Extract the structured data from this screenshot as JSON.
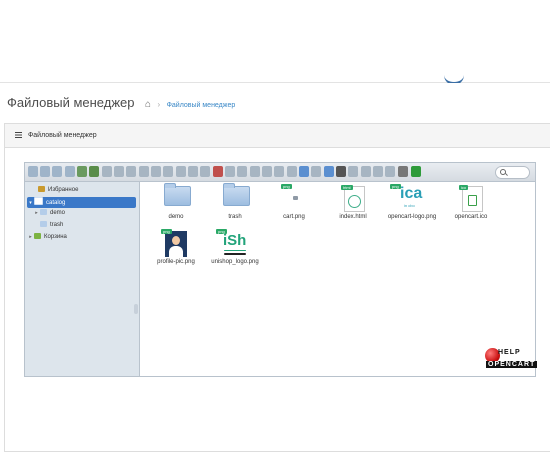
{
  "page": {
    "title": "Файловый менеджер",
    "breadcrumb": "Файловый менеджер"
  },
  "panel": {
    "heading": "Файловый менеджер"
  },
  "toolbar": {
    "icons": [
      {
        "name": "back-icon",
        "color": "#9fb4c9"
      },
      {
        "name": "forward-icon",
        "color": "#9fb4c9"
      },
      {
        "name": "up-icon",
        "color": "#9fb4c9"
      },
      {
        "name": "home-icon",
        "color": "#9fb4c9"
      },
      {
        "name": "reload-icon",
        "color": "#6a9a5f"
      },
      {
        "name": "download-icon",
        "color": "#5a8d4a"
      },
      {
        "name": "upload-icon",
        "color": "#a7b5c2"
      },
      {
        "name": "new-folder-icon",
        "color": "#a7b5c2"
      },
      {
        "name": "new-file-icon",
        "color": "#a7b5c2"
      },
      {
        "name": "open-icon",
        "color": "#a7b5c2"
      },
      {
        "name": "undo-icon",
        "color": "#a7b5c2"
      },
      {
        "name": "redo-icon",
        "color": "#a7b5c2"
      },
      {
        "name": "copy-icon",
        "color": "#a7b5c2"
      },
      {
        "name": "cut-icon",
        "color": "#a7b5c2"
      },
      {
        "name": "paste-icon",
        "color": "#a7b5c2"
      },
      {
        "name": "delete-icon",
        "color": "#c0504d"
      },
      {
        "name": "duplicate-icon",
        "color": "#a7b5c2"
      },
      {
        "name": "rename-icon",
        "color": "#a7b5c2"
      },
      {
        "name": "edit-icon",
        "color": "#a7b5c2"
      },
      {
        "name": "resize-icon",
        "color": "#a7b5c2"
      },
      {
        "name": "archive-icon",
        "color": "#a7b5c2"
      },
      {
        "name": "extract-icon",
        "color": "#a7b5c2"
      },
      {
        "name": "grid-view-icon",
        "color": "#5b8fd0"
      },
      {
        "name": "list-view-icon",
        "color": "#a7b5c2"
      },
      {
        "name": "select-icon",
        "color": "#5b8fd0"
      },
      {
        "name": "preview-icon",
        "color": "#555555"
      },
      {
        "name": "info-icon",
        "color": "#a7b5c2"
      },
      {
        "name": "sort-icon",
        "color": "#a7b5c2"
      },
      {
        "name": "places-icon",
        "color": "#a7b5c2"
      },
      {
        "name": "help-icon",
        "color": "#a7b5c2"
      },
      {
        "name": "settings-icon",
        "color": "#777777"
      },
      {
        "name": "fullscreen-icon",
        "color": "#2e9b3a"
      }
    ]
  },
  "tree": {
    "items": [
      {
        "label": "Избранное",
        "color": "#c99a2e"
      },
      {
        "label": "catalog",
        "color": "#ffffff"
      },
      {
        "label": "demo",
        "color": "#b4cde9"
      },
      {
        "label": "trash",
        "color": "#b4cde9"
      },
      {
        "label": "Корзина",
        "color": "#7cb342"
      }
    ]
  },
  "files": [
    {
      "name": "demo",
      "kind": "folder"
    },
    {
      "name": "trash",
      "kind": "folder"
    },
    {
      "name": "cart.png",
      "kind": "file",
      "badge": "png"
    },
    {
      "name": "index.html",
      "kind": "file",
      "badge": "html"
    },
    {
      "name": "opencart-logo.png",
      "kind": "file",
      "badge": "png"
    },
    {
      "name": "opencart.ico",
      "kind": "file",
      "badge": "ico"
    },
    {
      "name": "profile-pic.png",
      "kind": "file",
      "badge": "png"
    },
    {
      "name": "unishop_logo.png",
      "kind": "file",
      "badge": "png"
    }
  ],
  "thumbs": {
    "opencart_logo": {
      "text": "ica",
      "sub": "in cbo"
    },
    "unishop": {
      "text": "iSh"
    }
  },
  "watermark": {
    "line1": "HELP",
    "line2": "OPENCART"
  }
}
